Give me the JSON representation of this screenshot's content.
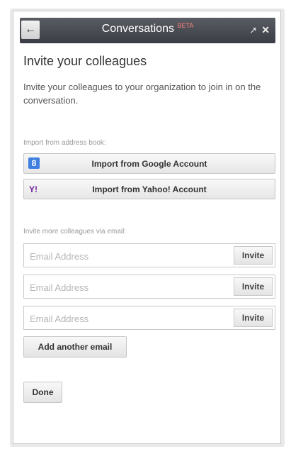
{
  "header": {
    "back_icon": "arrow-left-icon",
    "title": "Conversations",
    "badge": "BETA",
    "popout_icon": "popout-icon",
    "close_icon": "close-icon"
  },
  "main": {
    "heading": "Invite your colleagues",
    "intro": "Invite your colleagues to your organization to join in on the conversation.",
    "import_label": "Import from address book:",
    "google_button": "Import from Google Account",
    "google_icon_text": "8",
    "yahoo_button": "Import from Yahoo! Account",
    "yahoo_icon_text": "Y!",
    "email_label": "Invite more colleagues via email:",
    "email_fields": [
      {
        "placeholder": "Email Address",
        "value": "",
        "invite_label": "Invite"
      },
      {
        "placeholder": "Email Address",
        "value": "",
        "invite_label": "Invite"
      },
      {
        "placeholder": "Email Address",
        "value": "",
        "invite_label": "Invite"
      }
    ],
    "add_email_button": "Add another email",
    "done_button": "Done"
  },
  "colors": {
    "titlebar": "#45474e",
    "beta": "#ff7e7e",
    "google": "#3f7fe0",
    "yahoo": "#6b1f9a"
  }
}
